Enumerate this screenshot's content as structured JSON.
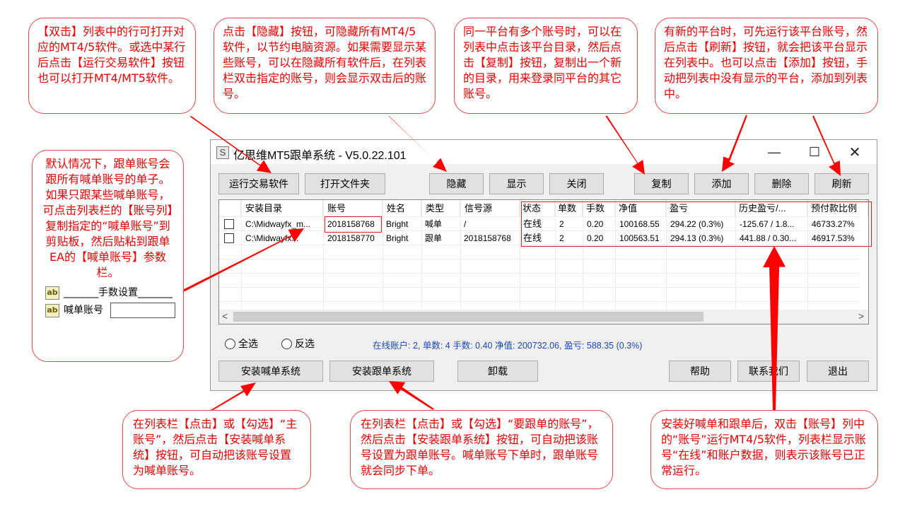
{
  "window": {
    "title": "亿思维MT5跟单系统 - V5.0.22.101",
    "app_icon": "S",
    "controls": {
      "minimize": "—",
      "maximize": "☐",
      "close": "✕"
    }
  },
  "toolbar": {
    "run_terminal": "运行交易软件",
    "open_folder": "打开文件夹",
    "hide": "隐藏",
    "show": "显示",
    "close": "关闭",
    "copy": "复制",
    "add": "添加",
    "delete": "删除",
    "refresh": "刷新"
  },
  "table": {
    "columns": [
      "安装目录",
      "账号",
      "姓名",
      "类型",
      "信号源",
      "状态",
      "单数",
      "手数",
      "净值",
      "盈亏",
      "历史盈亏/...",
      "预付款比例"
    ],
    "rows": [
      [
        "C:\\Midwayfx_m...",
        "2018158768",
        "Bright",
        "喊单",
        "/",
        "在线",
        "2",
        "0.20",
        "100168.55",
        "294.22 (0.3%)",
        "-125.67 / 1.8...",
        "46733.27%"
      ],
      [
        "C:\\Midwayfx...",
        "2018158770",
        "Bright",
        "跟单",
        "2018158768",
        "在线",
        "2",
        "0.20",
        "100563.51",
        "294.13 (0.3%)",
        "441.88 / 0.30...",
        "46917.53%"
      ]
    ]
  },
  "scroll": {
    "left": "<",
    "right": ">"
  },
  "selection": {
    "select_all": "全选",
    "invert": "反选"
  },
  "status_line": "在线账户: 2,  单数: 4  手数: 0.40  净值: 200732.06,  盈亏: 588.35 (0.3%)",
  "bottom": {
    "install_master": "安装喊单系统",
    "install_follower": "安装跟单系统",
    "uninstall": "卸载",
    "help": "帮助",
    "contact": "联系我们",
    "exit": "退出"
  },
  "callouts": {
    "double_click": "【双击】列表中的行可打开对应的MT4/5软件。或选中某行后点击【运行交易软件】按钮也可以打开MT4/MT5软件。",
    "hide": "点击【隐藏】按钮，可隐藏所有MT4/5软件，以节约电脑资源。如果需要显示某些账号，可以在隐藏所有软件后，在列表栏双击指定的账号，则会显示双击后的账号。",
    "copy": "同一平台有多个账号时，可以在列表中点击该平台目录，然后点击【复制】按钮，复制出一个新的目录，用来登录同平台的其它账号。",
    "refresh_add": "有新的平台时，可先运行该平台账号，然后点击【刷新】按钮，就会把该平台显示在列表中。也可以点击【添加】按钮，手动把列表中没有显示的平台，添加到列表中。",
    "master_account": "默认情况下，跟单账号会跟所有喊单账号的单子。如果只跟某些喊单账号，可点击列表栏的【账号列】复制指定的“喊单账号”到剪贴板，然后贴粘到跟单EA的【喊单账号】参数栏。",
    "install_master": "在列表栏【点击】或【勾选】“主账号”，然后点击【安装喊单系统】按钮，可自动把该账号设置为喊单账号。",
    "install_follower": "在列表栏【点击】或【勾选】“要跟单的账号”，然后点击【安装跟单系统】按钮，可自动把该账号设置为跟单账号。喊单账号下单时，跟单账号就会同步下单。",
    "online": "安装好喊单和跟单后，双击【账号】列中的“账号”运行MT4/5软件，列表栏显示账号“在线”和账户数据，则表示该账号已正常运行。"
  },
  "ea_params": {
    "icon": "ab",
    "title": "_______手数设置_______",
    "master_account_label": "喊单账号"
  },
  "colors": {
    "callout_text": "#e60000",
    "arrow": "#ff0000",
    "status_text": "#1a47c2"
  }
}
